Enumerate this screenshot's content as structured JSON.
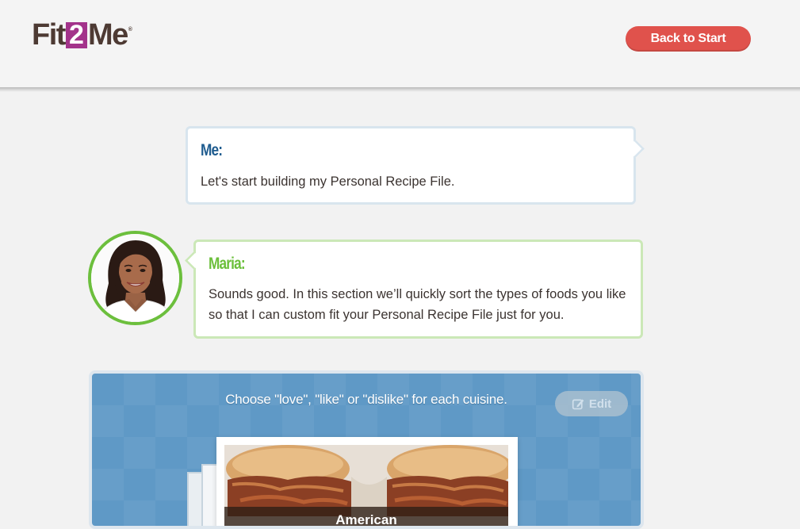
{
  "header": {
    "logo": {
      "part1": "Fit",
      "part2": "2",
      "part3": "Me",
      "tm": "®"
    },
    "back_button": "Back to Start"
  },
  "conversation": {
    "me": {
      "speaker": "Me:",
      "text": "Let's start building my Personal Recipe File."
    },
    "maria": {
      "speaker": "Maria:",
      "text": "Sounds good. In this section we’ll quickly sort the types of foods you like so that I can custom fit your Personal Recipe File just for you.",
      "avatar_icon": "maria-avatar-photo"
    }
  },
  "cuisine_panel": {
    "instruction": "Choose \"love\", \"like\" or \"dislike\" for each cuisine.",
    "edit_button": "Edit",
    "edit_icon": "edit-pencil-icon",
    "current_card": {
      "label": "American",
      "image": "pulled-pork-sandwiches-photo"
    }
  },
  "colors": {
    "brand_purple": "#a3338b",
    "brand_brown": "#4d3a33",
    "back_button": "#e0524c",
    "me_speaker": "#1f5c8f",
    "maria_speaker": "#6bbf3a",
    "panel_blue": "#5f99c6"
  }
}
